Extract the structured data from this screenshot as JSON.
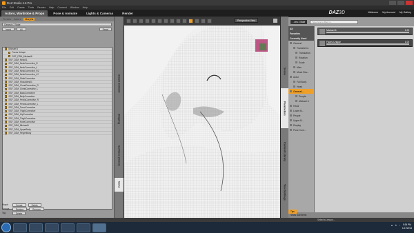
{
  "window": {
    "title": "DAZ Studio 4.6 Pro"
  },
  "menu": [
    "File",
    "Edit",
    "Create",
    "Tools",
    "Render",
    "Help",
    "Connect",
    "Window",
    "Help"
  ],
  "tabs": [
    {
      "label": "Actors, Wardrobe & Props",
      "active": true
    },
    {
      "label": "Pose & Animate"
    },
    {
      "label": "Lights & Cameras"
    },
    {
      "label": "Render"
    }
  ],
  "brand": {
    "text": "DAZ",
    "sub": "3D"
  },
  "toplinks": [
    "Welcome",
    "My Account",
    "My Gallery"
  ],
  "left": {
    "tabs": [
      "Presets",
      "Actors",
      "Morphs"
    ],
    "selected": "Genesis 2 Male",
    "buttons": {
      "invert": "Invert",
      "all": "All",
      "reset": "Reset"
    },
    "list": [
      {
        "label": "Michael 6",
        "sub": false
      },
      {
        "label": "Faces Unique",
        "sub": true
      },
      {
        "label": "SSF_D2M_Michael6",
        "sub": true
      },
      {
        "label": "SSF_D2M_Neck01",
        "sub": false
      },
      {
        "label": "SSF_D2M_NeckCorrective_R",
        "sub": false
      },
      {
        "label": "SSF_D2M_NeckCorrective_L",
        "sub": false
      },
      {
        "label": "SSF_D2M_NeckCorrective_R2",
        "sub": false
      },
      {
        "label": "SSF_D2M_NeckCorrective_L2",
        "sub": false
      },
      {
        "label": "SSF_D2M_ShldrCorrective",
        "sub": false
      },
      {
        "label": "SSF_D2M_Shoulders01",
        "sub": false
      },
      {
        "label": "SSF_D2M_ChestCorrective_R",
        "sub": false
      },
      {
        "label": "SSF_D2M_ChestCorrective_L",
        "sub": false
      },
      {
        "label": "SSF_D2M_BackCorrective",
        "sub": false
      },
      {
        "label": "SSF_D2M_BellyCorrective",
        "sub": false
      },
      {
        "label": "SSF_D2M_PelvisCorrective_R",
        "sub": false
      },
      {
        "label": "SSF_D2M_PelvisCorrective_L",
        "sub": false
      },
      {
        "label": "SSF_D2M_TorsoCorrective",
        "sub": false
      },
      {
        "label": "SSF_D2M_ThighCorrective",
        "sub": false
      },
      {
        "label": "SSF_D2M_HipCorrective",
        "sub": false
      },
      {
        "label": "SSF_D2M_ThighCorrective",
        "sub": false
      },
      {
        "label": "SSF_D2M_KneeCorrective",
        "sub": false
      },
      {
        "label": "SSF_D2M_Michael6",
        "sub": false
      },
      {
        "label": "SSF_D2M_UpperBody",
        "sub": false
      },
      {
        "label": "SSF_D2M_FingerBody",
        "sub": false
      }
    ],
    "bottom": [
      {
        "label": "Morph",
        "buttons": [
          "Create",
          "Delete"
        ]
      },
      {
        "label": "Groups",
        "buttons": [
          "Restore",
          "Remove"
        ]
      },
      {
        "label": "Tag",
        "buttons": [
          "Delete"
        ]
      }
    ]
  },
  "left_vtabs": [
    "Smart Content",
    "Shaping",
    "Surfaces (Color)",
    "Genx"
  ],
  "viewport": {
    "camera": "Perspective View"
  },
  "right": {
    "dropdown": "...ens 2 Male",
    "filter_placeholder": "Type here to filter in...",
    "categories": [
      {
        "label": "All",
        "type": "hd"
      },
      {
        "label": "Favorites",
        "type": "hd"
      },
      {
        "label": "Currently Used",
        "type": "hd"
      },
      {
        "label": "General",
        "type": "c"
      },
      {
        "label": "Transforms",
        "type": "sub"
      },
      {
        "label": "Translation",
        "type": "sub2"
      },
      {
        "label": "Rotation",
        "type": "sub2"
      },
      {
        "label": "Scale",
        "type": "sub2"
      },
      {
        "label": "Misc",
        "type": "sub"
      },
      {
        "label": "Mesh Res...",
        "type": "sub"
      },
      {
        "label": "Actor",
        "type": "c"
      },
      {
        "label": "Full Body",
        "type": "sub"
      },
      {
        "label": "Head",
        "type": "sub"
      },
      {
        "label": "Generali...",
        "type": "sel"
      },
      {
        "label": "People",
        "type": "sub2"
      },
      {
        "label": "Michael 6",
        "type": "sub2"
      },
      {
        "label": "Head",
        "type": "c"
      },
      {
        "label": "Lower B...",
        "type": "c"
      },
      {
        "label": "People",
        "type": "c"
      },
      {
        "label": "Upper B...",
        "type": "c"
      },
      {
        "label": "Display",
        "type": "c"
      },
      {
        "label": "Pose Cont...",
        "type": "c"
      }
    ],
    "params": [
      {
        "name": "Michael 6",
        "value": "1.00"
      },
      {
        "name": "Faces Unique",
        "value": "1.00"
      }
    ],
    "foot": "Show Sub Items",
    "tips": "Tips"
  },
  "right_vtabs": [
    "Scene",
    "Parameters",
    "Content Library",
    "Tool Settings"
  ],
  "status": {
    "lesson": "Select a Lesson..."
  },
  "taskbar": {
    "time": "5:36 PM",
    "date": "1/17/2014"
  }
}
